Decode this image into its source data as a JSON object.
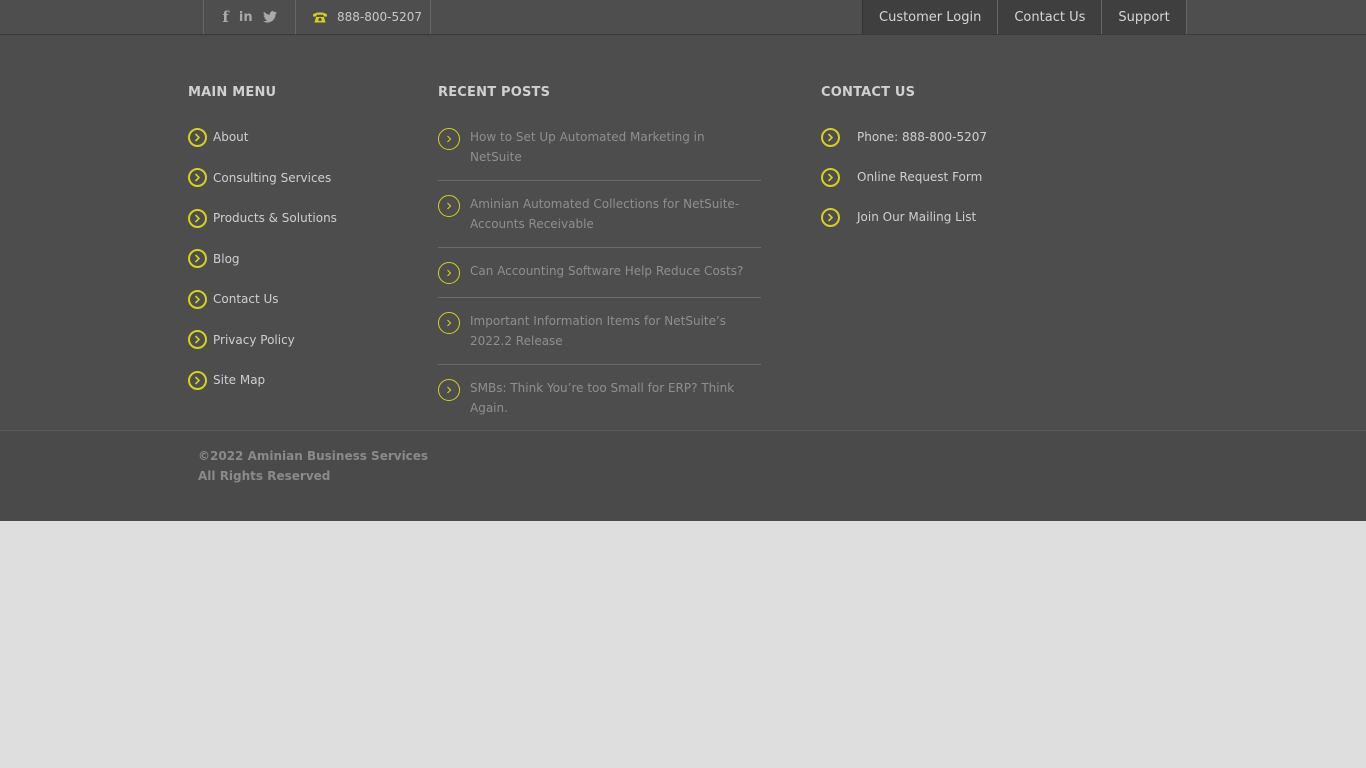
{
  "topbar": {
    "social": [
      {
        "icon": "facebook-icon",
        "glyph": "f"
      },
      {
        "icon": "linkedin-icon",
        "glyph": "in"
      },
      {
        "icon": "twitter-icon",
        "glyph": ""
      }
    ],
    "phone": "888-800-5207",
    "nav": [
      {
        "label": "Customer Login"
      },
      {
        "label": "Contact Us"
      },
      {
        "label": "Support"
      }
    ]
  },
  "footer": {
    "main_menu": {
      "title": "MAIN MENU",
      "items": [
        {
          "label": "About"
        },
        {
          "label": "Consulting Services"
        },
        {
          "label": "Products & Solutions"
        },
        {
          "label": "Blog"
        },
        {
          "label": "Contact Us"
        },
        {
          "label": "Privacy Policy"
        },
        {
          "label": "Site Map"
        }
      ]
    },
    "recent_posts": {
      "title": "RECENT POSTS",
      "items": [
        {
          "label": "How to Set Up Automated Marketing in NetSuite"
        },
        {
          "label": "Aminian Automated Collections for NetSuite- Accounts Receivable"
        },
        {
          "label": "Can Accounting Software Help Reduce Costs?"
        },
        {
          "label": "Important Information Items for NetSuite’s 2022.2 Release"
        },
        {
          "label": "SMBs: Think You’re too Small for ERP? Think Again."
        }
      ]
    },
    "contact_us": {
      "title": "CONTACT US",
      "items": [
        {
          "label": "Phone: 888-800-5207"
        },
        {
          "label": "Online Request Form"
        },
        {
          "label": "Join Our Mailing List"
        }
      ]
    }
  },
  "bottom": {
    "copyright_line1": "©2022 Aminian Business Services",
    "copyright_line2": "All Rights Reserved"
  },
  "colors": {
    "accent": "#d7d11d",
    "footer_bg": "#4d4d4d",
    "topbar_bg": "#4e4e4e",
    "nav_bg": "#3f3f3f",
    "page_bg": "#dedede"
  }
}
